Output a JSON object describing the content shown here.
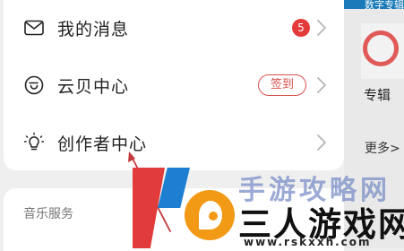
{
  "menu": {
    "items": [
      {
        "label": "我的消息",
        "icon": "mail-icon",
        "badge": "5"
      },
      {
        "label": "云贝中心",
        "icon": "coin-icon",
        "action_label": "签到"
      },
      {
        "label": "创作者中心",
        "icon": "lightbulb-icon"
      }
    ]
  },
  "services": {
    "title": "音乐服务"
  },
  "background": {
    "album_label": "专辑",
    "more_label": "更多>",
    "band_text": "数字专辑"
  },
  "watermark": {
    "ghost_text": "手游攻略网",
    "brand": "三人游戏网",
    "url": "www.rskxxh.com"
  },
  "colors": {
    "badge": "#e33a3a",
    "signin": "#d8504a",
    "arrow": "#c43a3a"
  }
}
